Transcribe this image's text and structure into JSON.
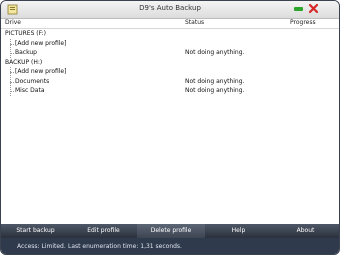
{
  "window": {
    "title": "D9's Auto Backup"
  },
  "columns": {
    "drive": "Drive",
    "status": "Status",
    "progress": "Progress"
  },
  "tree": {
    "pictures": {
      "label": "PICTURES (F:)",
      "add_profile": "[Add new profile]",
      "profiles": [
        {
          "name": "Backup",
          "status": "Not doing anything."
        }
      ]
    },
    "backup": {
      "label": "BACKUP (H:)",
      "add_profile": "[Add new profile]",
      "profiles": [
        {
          "name": "Documents",
          "status": "Not doing anything."
        },
        {
          "name": "Misc Data",
          "status": "Not doing anything."
        }
      ]
    }
  },
  "toolbar": {
    "start_backup": "Start backup",
    "edit_profile": "Edit profile",
    "delete_profile": "Delete profile",
    "help": "Help",
    "about": "About"
  },
  "statusbar": {
    "access": "Access: Limited.",
    "enumeration": "Last enumeration time: 1,31 seconds."
  },
  "icons": {
    "app": "backup-folder-icon",
    "minimize": "minimize-icon",
    "close": "close-icon"
  },
  "colors": {
    "toolbar": "#3a4250",
    "statusbar": "#2f3a4c",
    "minimize": "#2da52d",
    "close": "#d62828"
  }
}
